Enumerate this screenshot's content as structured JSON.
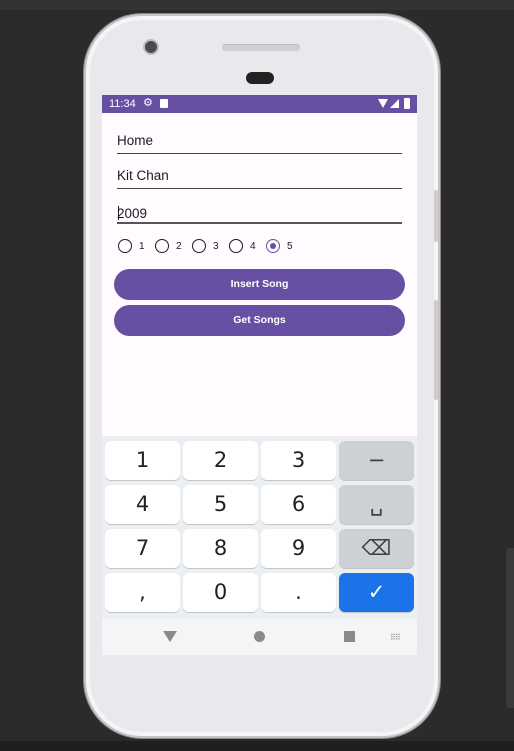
{
  "status_bar": {
    "time": "11:34",
    "icons": [
      "settings-icon",
      "sd-card-icon",
      "wifi-icon",
      "signal-icon",
      "battery-icon"
    ],
    "background": "#6750a4"
  },
  "form": {
    "fields": [
      {
        "value": "Home"
      },
      {
        "value": "Kit Chan"
      },
      {
        "value": "2009"
      }
    ],
    "rating_options": [
      "1",
      "2",
      "3",
      "4",
      "5"
    ],
    "selected_rating": "5",
    "insert_button": "Insert Song",
    "get_button": "Get Songs",
    "accent_color": "#6750a4"
  },
  "keyboard": {
    "rows": [
      [
        "1",
        "2",
        "3",
        "−"
      ],
      [
        "4",
        "5",
        "6",
        "␣"
      ],
      [
        "7",
        "8",
        "9",
        "⌫"
      ],
      [
        ",",
        "0",
        ".",
        "✓"
      ]
    ],
    "enter_color": "#1a73e8"
  },
  "nav_bar": {
    "icons": [
      "back-icon",
      "home-icon",
      "recents-icon",
      "keyboard-switch-icon"
    ]
  }
}
